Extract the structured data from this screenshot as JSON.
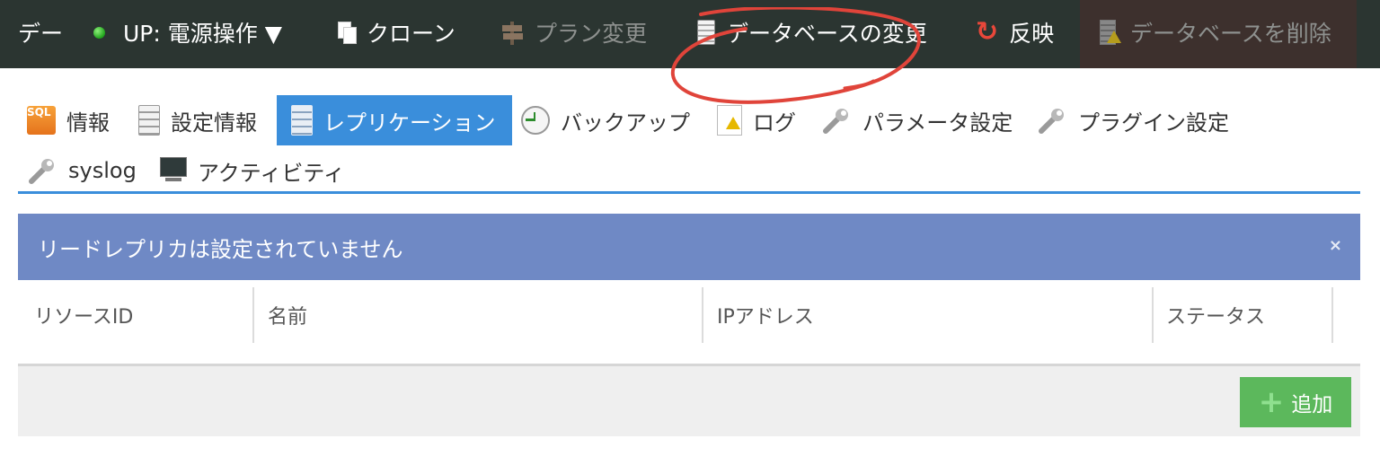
{
  "toolbar": {
    "truncated_title": "デー",
    "power": "UP: 電源操作 ▼",
    "clone": "クローン",
    "plan_change": "プラン変更",
    "db_change": "データベースの変更",
    "reflect": "反映",
    "db_delete": "データベースを削除"
  },
  "tabs": [
    {
      "label": "情報",
      "icon": "sql-icon"
    },
    {
      "label": "設定情報",
      "icon": "server-icon"
    },
    {
      "label": "レプリケーション",
      "icon": "server-icon",
      "active": true
    },
    {
      "label": "バックアップ",
      "icon": "backup-clock-icon"
    },
    {
      "label": "ログ",
      "icon": "log-warning-icon"
    },
    {
      "label": "パラメータ設定",
      "icon": "wrench-icon"
    },
    {
      "label": "プラグイン設定",
      "icon": "wrench-icon"
    },
    {
      "label": "syslog",
      "icon": "wrench-icon"
    },
    {
      "label": "アクティビティ",
      "icon": "monitor-icon"
    }
  ],
  "alert": {
    "message": "リードレプリカは設定されていません",
    "close": "×"
  },
  "table": {
    "columns": [
      "リソースID",
      "名前",
      "IPアドレス",
      "ステータス"
    ]
  },
  "footer": {
    "add_label": "追加"
  },
  "colors": {
    "toolbar_bg": "#2b3531",
    "accent_blue": "#3a8edb",
    "alert_bg": "#6f89c5",
    "add_green": "#5cb85c",
    "annotation_red": "#e0443a"
  }
}
